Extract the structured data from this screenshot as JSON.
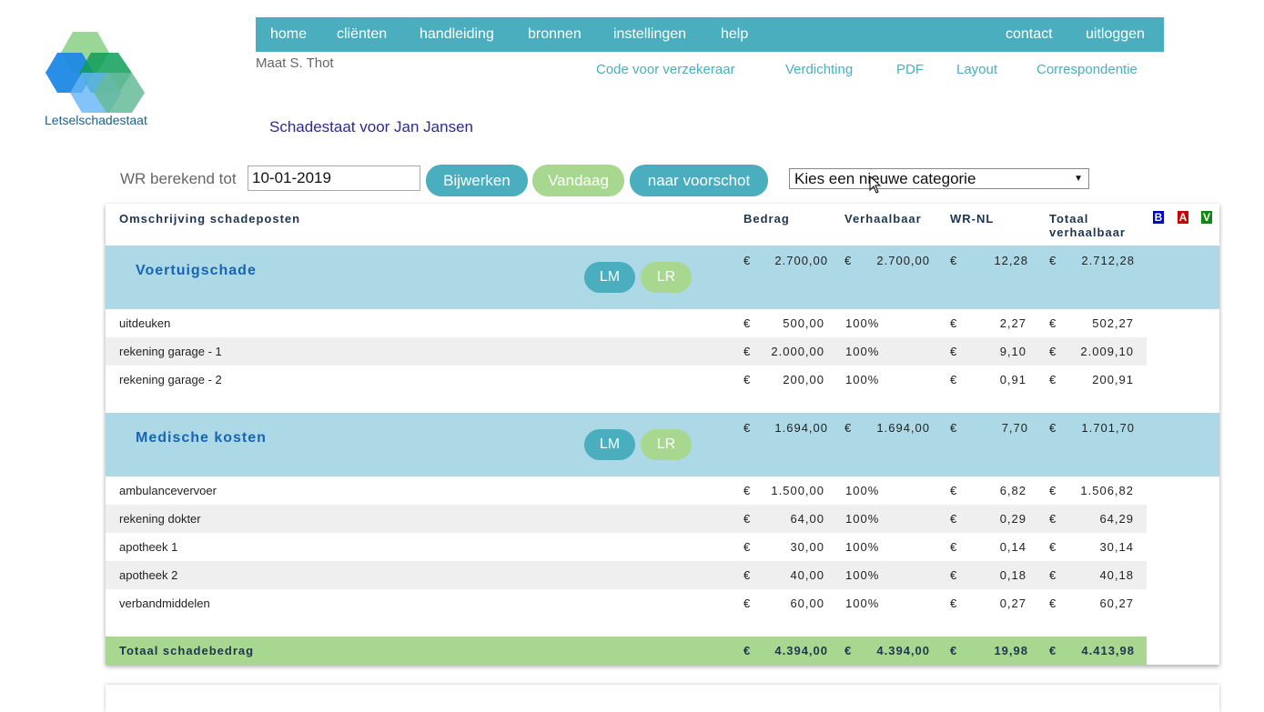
{
  "logo": {
    "text": "Letselschadestaat"
  },
  "nav": {
    "left": [
      "home",
      "cliënten",
      "handleiding",
      "bronnen",
      "instellingen",
      "help"
    ],
    "right": [
      "contact",
      "uitloggen"
    ]
  },
  "user": "Maat S. Thot",
  "subnav": [
    "Code voor verzekeraar",
    "Verdichting",
    "PDF",
    "Layout",
    "Correspondentie"
  ],
  "page_title": "Schadestaat voor Jan Jansen",
  "controls": {
    "wr_label": "WR berekend tot",
    "date_value": "10-01-2019",
    "btn_bijwerken": "Bijwerken",
    "btn_vandaag": "Vandaag",
    "btn_voorschot": "naar voorschot",
    "select_value": "Kies een nieuwe categorie"
  },
  "table": {
    "headers": {
      "desc": "Omschrijving schadeposten",
      "bedrag": "Bedrag",
      "verhaalbaar": "Verhaalbaar",
      "wr": "WR-NL",
      "totaal_1": "Totaal",
      "totaal_2": "verhaalbaar"
    },
    "flags": [
      "B",
      "A",
      "V"
    ],
    "currency": "€",
    "categories": [
      {
        "title": "Voertuigschade",
        "btn_lm": "LM",
        "btn_lr": "LR",
        "bedrag": "2.700,00",
        "verhaalbaar": "2.700,00",
        "wr": "12,28",
        "totaal": "2.712,28",
        "items": [
          {
            "desc": "uitdeuken",
            "bedrag": "500,00",
            "pct": "100%",
            "wr": "2,27",
            "totaal": "502,27"
          },
          {
            "desc": "rekening garage - 1",
            "bedrag": "2.000,00",
            "pct": "100%",
            "wr": "9,10",
            "totaal": "2.009,10"
          },
          {
            "desc": "rekening garage - 2",
            "bedrag": "200,00",
            "pct": "100%",
            "wr": "0,91",
            "totaal": "200,91"
          }
        ]
      },
      {
        "title": "Medische kosten",
        "btn_lm": "LM",
        "btn_lr": "LR",
        "bedrag": "1.694,00",
        "verhaalbaar": "1.694,00",
        "wr": "7,70",
        "totaal": "1.701,70",
        "items": [
          {
            "desc": "ambulancevervoer",
            "bedrag": "1.500,00",
            "pct": "100%",
            "wr": "6,82",
            "totaal": "1.506,82"
          },
          {
            "desc": "rekening dokter",
            "bedrag": "64,00",
            "pct": "100%",
            "wr": "0,29",
            "totaal": "64,29"
          },
          {
            "desc": "apotheek 1",
            "bedrag": "30,00",
            "pct": "100%",
            "wr": "0,14",
            "totaal": "30,14"
          },
          {
            "desc": "apotheek 2",
            "bedrag": "40,00",
            "pct": "100%",
            "wr": "0,18",
            "totaal": "40,18"
          },
          {
            "desc": "verbandmiddelen",
            "bedrag": "60,00",
            "pct": "100%",
            "wr": "0,27",
            "totaal": "60,27"
          }
        ]
      }
    ],
    "total": {
      "label": "Totaal schadebedrag",
      "bedrag": "4.394,00",
      "verhaalbaar": "4.394,00",
      "wr": "19,98",
      "totaal": "4.413,98"
    }
  },
  "colors": {
    "teal": "#4aaebe",
    "green": "#a8d890",
    "category_bg": "#add8e6",
    "flag_b": "#0000cc",
    "flag_a": "#cc0000",
    "flag_v": "#118811"
  }
}
